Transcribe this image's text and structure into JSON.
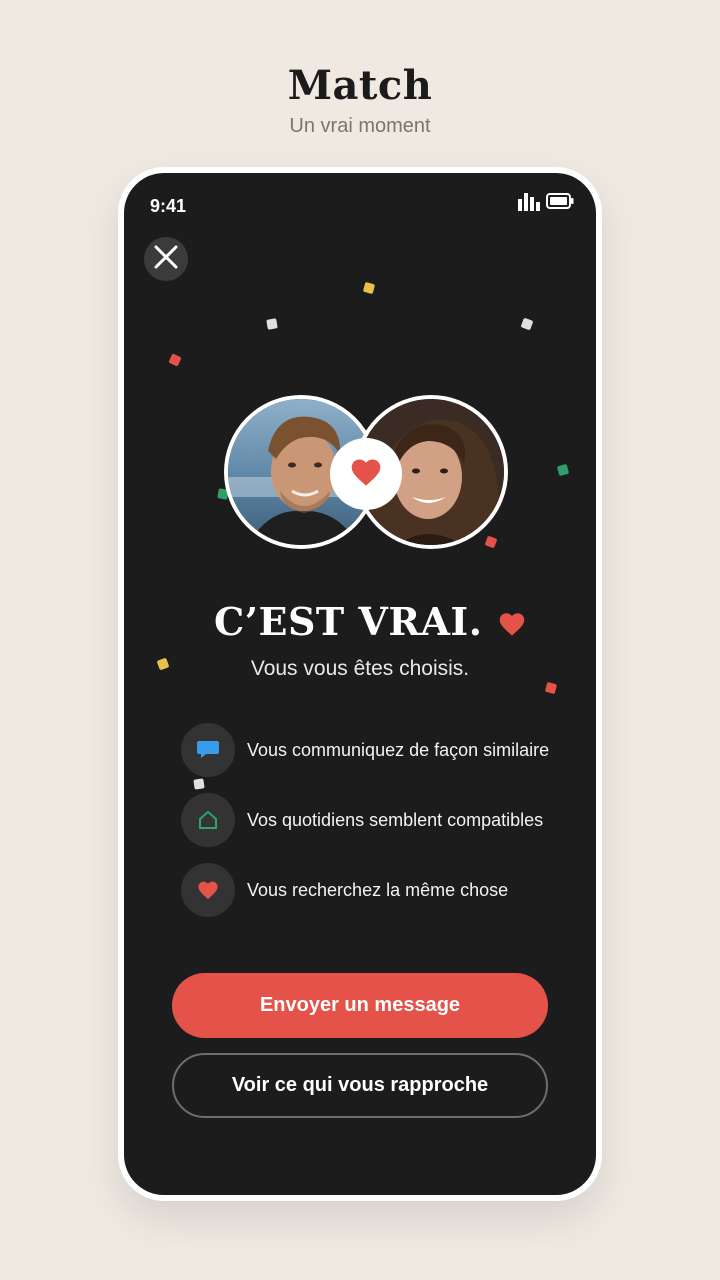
{
  "header": {
    "title": "Match",
    "subtitle": "Un vrai moment"
  },
  "status_bar": {
    "time": "9:41",
    "icons": [
      "signal-icon",
      "battery-icon"
    ]
  },
  "match_screen": {
    "close_icon": "close-icon",
    "left_profile_photo": "man-smiling-photo",
    "right_profile_photo": "woman-smiling-photo",
    "center_badge_icon": "heart-icon",
    "title": "C’EST VRAI.",
    "subtitle": "Vous vous êtes choisis.",
    "reasons": [
      {
        "icon": "chat-bubble-icon",
        "text": "Vous communiquez de façon similaire",
        "color": "#3a9be8"
      },
      {
        "icon": "home-icon",
        "text": "Vos quotidiens semblent compatibles",
        "color": "#2fa46a"
      },
      {
        "icon": "heart-icon",
        "text": "Vous recherchez la même chose",
        "color": "#e5524a"
      }
    ],
    "primary_button": "Envoyer un message",
    "secondary_button": "Voir ce qui vous rapproche"
  },
  "colors": {
    "background": "#efe9e2",
    "screen": "#1c1c1c",
    "accent": "#e5524a",
    "confetti": [
      "#e8c04a",
      "#e0e0e0",
      "#e5524a",
      "#2f9e6a"
    ]
  }
}
